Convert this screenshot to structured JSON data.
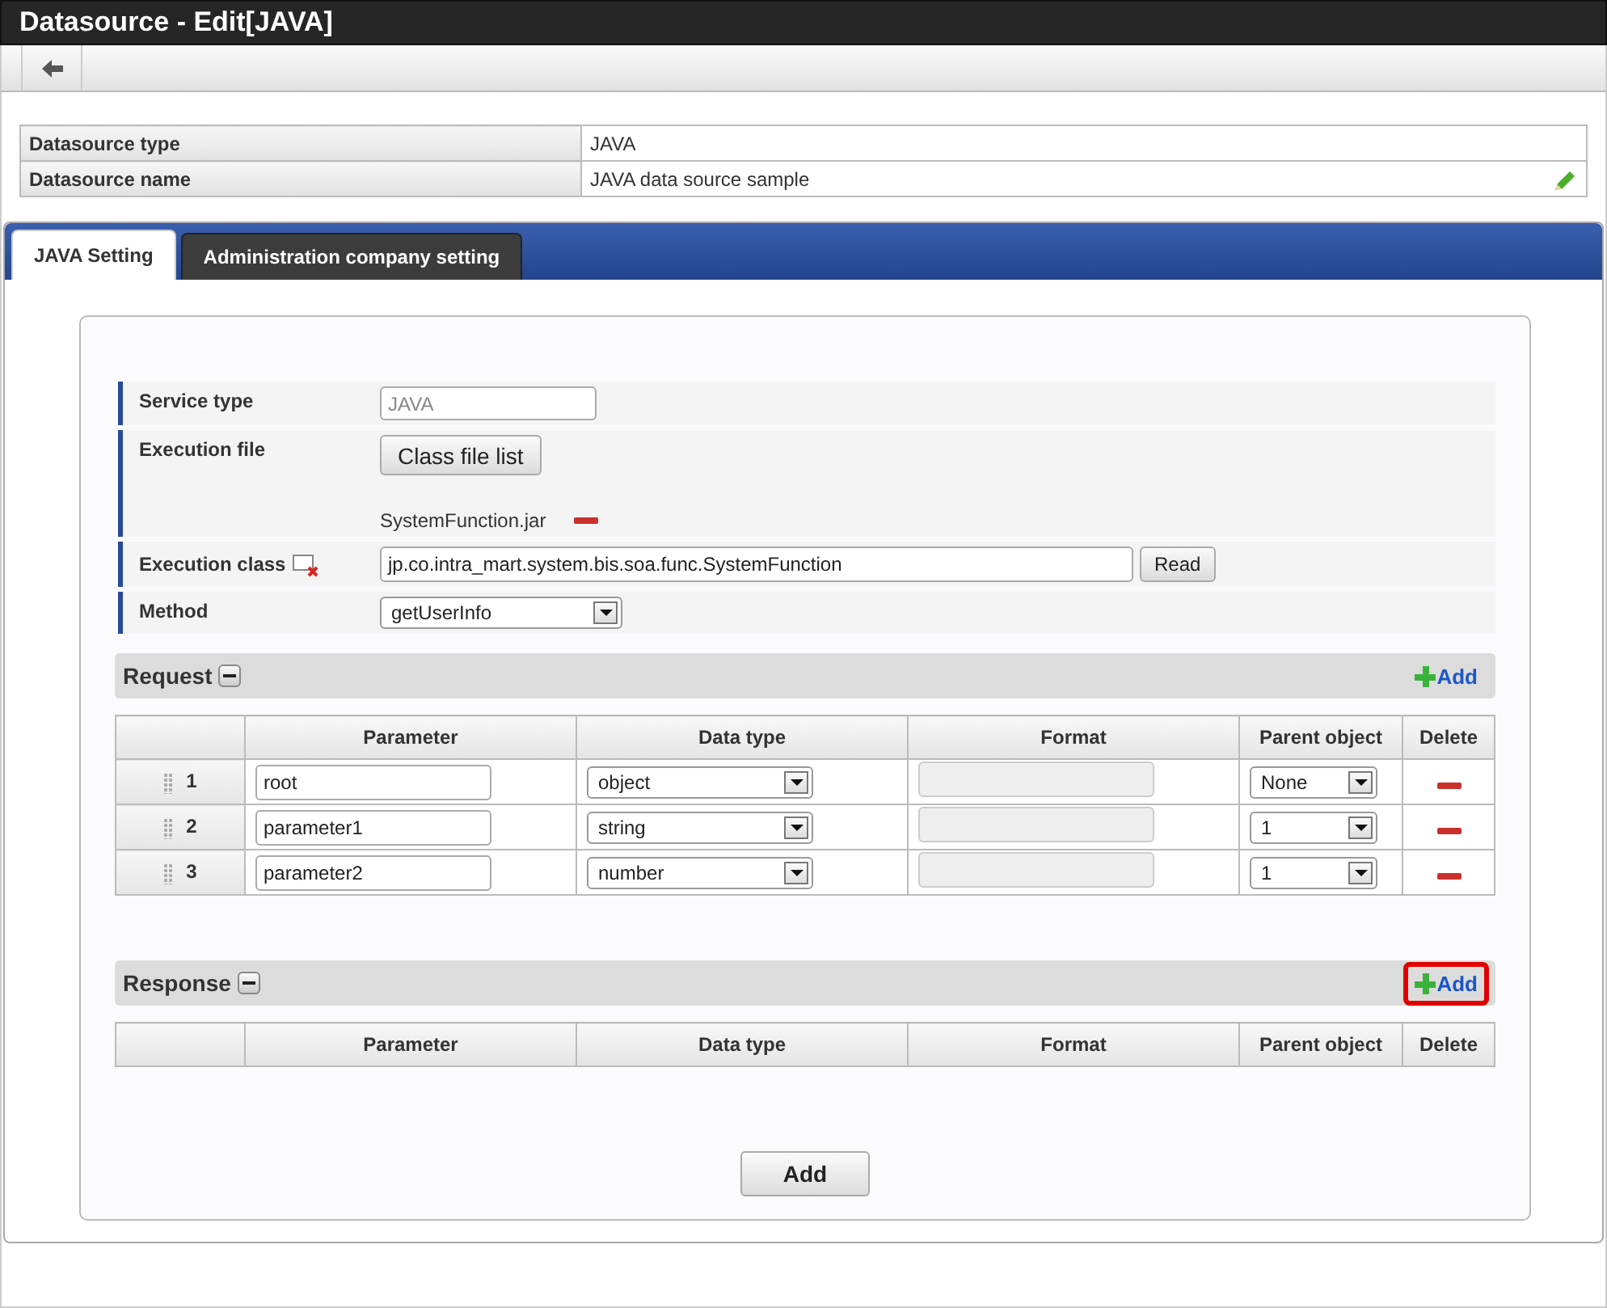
{
  "window": {
    "title": "Datasource - Edit[JAVA]"
  },
  "info": [
    {
      "label": "Datasource type",
      "value": "JAVA",
      "editable": false
    },
    {
      "label": "Datasource name",
      "value": "JAVA data source sample",
      "editable": true
    }
  ],
  "tabs": [
    {
      "label": "JAVA Setting",
      "selected": true
    },
    {
      "label": "Administration company setting",
      "selected": false
    }
  ],
  "settings": {
    "service_type": {
      "label": "Service type",
      "value": "JAVA"
    },
    "execution_file": {
      "label": "Execution file",
      "button": "Class file list",
      "files": [
        "SystemFunction.jar"
      ]
    },
    "execution_class": {
      "label": "Execution class",
      "value": "jp.co.intra_mart.system.bis.soa.func.SystemFunction",
      "button": "Read"
    },
    "method": {
      "label": "Method",
      "value": "getUserInfo"
    }
  },
  "sections": [
    {
      "title": "Request",
      "add": "Add",
      "highlighted": false,
      "columns": [
        "Parameter",
        "Data type",
        "Format",
        "Parent object",
        "Delete"
      ],
      "rows": [
        {
          "index": "1",
          "parameter": "root",
          "data_type": "object",
          "parent": "None"
        },
        {
          "index": "2",
          "parameter": "parameter1",
          "data_type": "string",
          "parent": "1"
        },
        {
          "index": "3",
          "parameter": "parameter2",
          "data_type": "number",
          "parent": "1"
        }
      ]
    },
    {
      "title": "Response",
      "add": "Add",
      "highlighted": true,
      "columns": [
        "Parameter",
        "Data type",
        "Format",
        "Parent object",
        "Delete"
      ]
    }
  ],
  "footer_button": "Add"
}
